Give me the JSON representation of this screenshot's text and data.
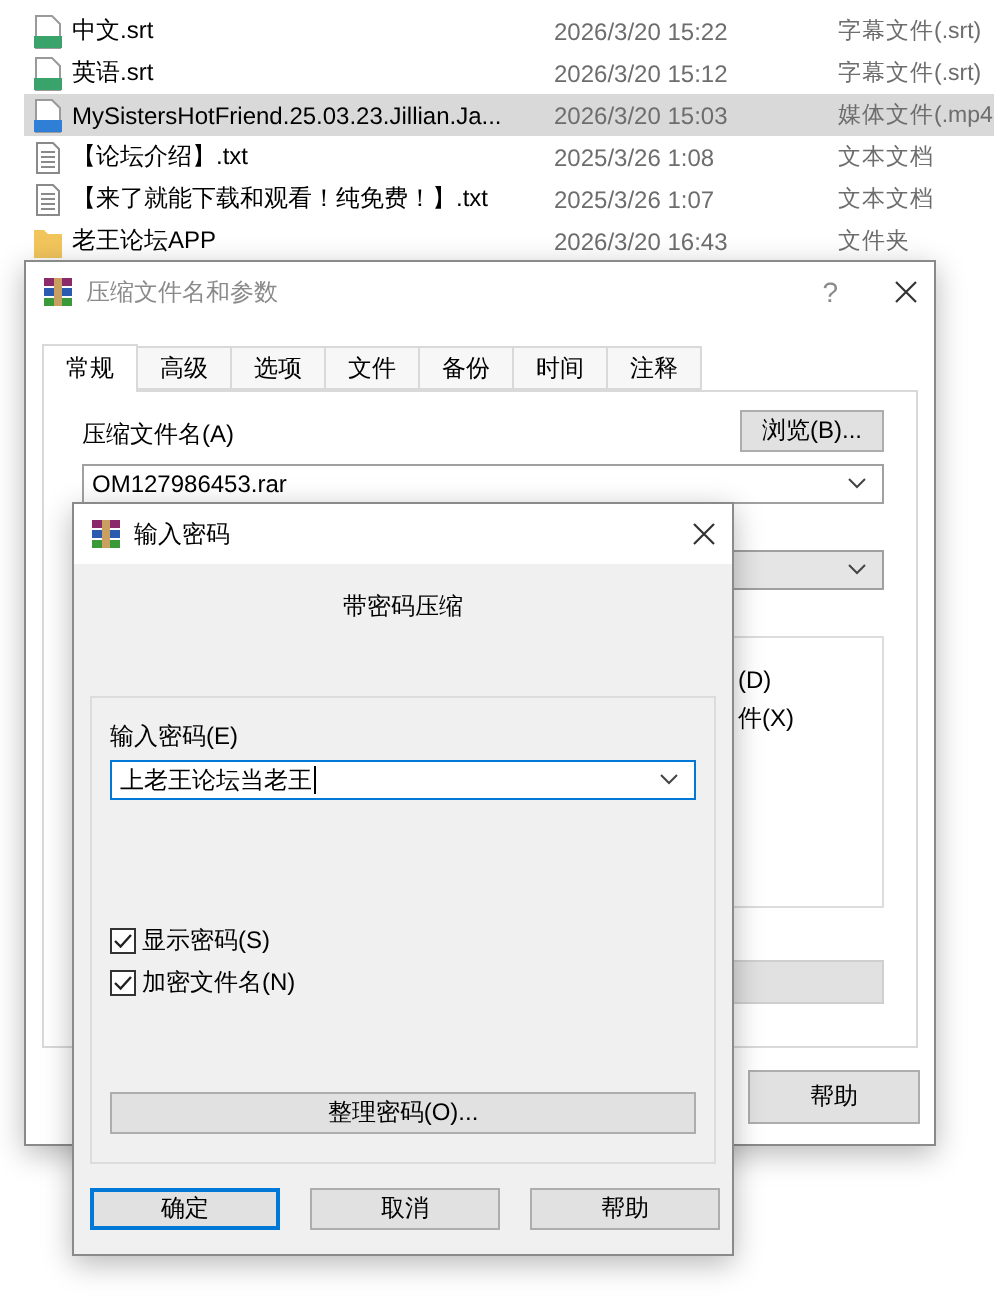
{
  "file_list": [
    {
      "kind": "srt",
      "name": "中文.srt",
      "date": "2026/3/20 15:22",
      "type": "字幕文件(.srt)",
      "selected": false
    },
    {
      "kind": "srt",
      "name": "英语.srt",
      "date": "2026/3/20 15:12",
      "type": "字幕文件(.srt)",
      "selected": false
    },
    {
      "kind": "mp4",
      "name": "MySistersHotFriend.25.03.23.Jillian.Ja...",
      "date": "2026/3/20 15:03",
      "type": "媒体文件(.mp4",
      "selected": true
    },
    {
      "kind": "txt",
      "name": "【论坛介绍】.txt",
      "date": "2025/3/26 1:08",
      "type": "文本文档",
      "selected": false
    },
    {
      "kind": "txt",
      "name": "【来了就能下载和观看！纯免费！】.txt",
      "date": "2025/3/26 1:07",
      "type": "文本文档",
      "selected": false
    },
    {
      "kind": "folder",
      "name": "老王论坛APP",
      "date": "2026/3/20 16:43",
      "type": "文件夹",
      "selected": false
    }
  ],
  "archive_dialog": {
    "title": "压缩文件名和参数",
    "help_glyph": "?",
    "tabs": [
      {
        "label": "常规",
        "selected": true
      },
      {
        "label": "高级",
        "selected": false
      },
      {
        "label": "选项",
        "selected": false
      },
      {
        "label": "文件",
        "selected": false
      },
      {
        "label": "备份",
        "selected": false
      },
      {
        "label": "时间",
        "selected": false
      },
      {
        "label": "注释",
        "selected": false
      }
    ],
    "archive_name_label": "压缩文件名(A)",
    "browse_button": "浏览(B)...",
    "archive_name": "OM127986453.rar",
    "partial_options": [
      "(D)",
      "件(X)"
    ],
    "help_button": "帮助"
  },
  "password_dialog": {
    "title": "输入密码",
    "heading": "带密码压缩",
    "password_label": "输入密码(E)",
    "password": "上老王论坛当老王",
    "checkboxes": [
      {
        "label": "显示密码(S)",
        "checked": true
      },
      {
        "label": "加密文件名(N)",
        "checked": true
      }
    ],
    "organize_button": "整理密码(O)...",
    "buttons": [
      {
        "label": "确定",
        "default": true
      },
      {
        "label": "取消",
        "default": false
      },
      {
        "label": "帮助",
        "default": false
      }
    ]
  }
}
